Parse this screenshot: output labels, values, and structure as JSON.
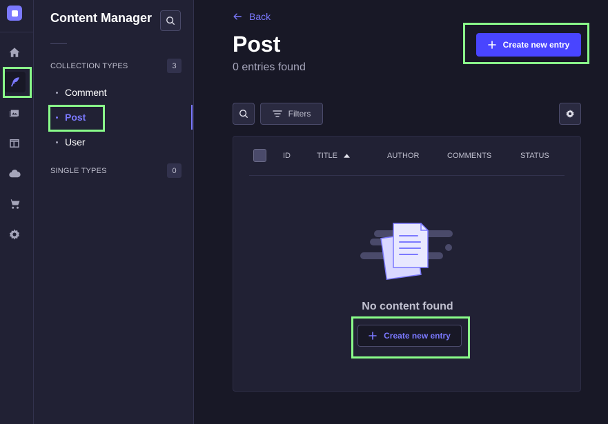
{
  "colors": {
    "background": "#181826",
    "panel": "#212134",
    "accent": "#7b79ff",
    "primary_button": "#4945ff",
    "highlight": "#8aff8a"
  },
  "rail": {
    "logo": "strapi-logo",
    "items": [
      {
        "icon": "home-icon"
      },
      {
        "icon": "feather-icon"
      },
      {
        "icon": "media-library-icon"
      },
      {
        "icon": "layout-icon"
      },
      {
        "icon": "cloud-icon"
      },
      {
        "icon": "cart-icon"
      },
      {
        "icon": "gear-icon"
      }
    ]
  },
  "subnav": {
    "title": "Content Manager",
    "search_icon": "search-icon",
    "collection_types": {
      "label": "COLLECTION TYPES",
      "count": "3",
      "items": [
        {
          "label": "Comment"
        },
        {
          "label": "Post"
        },
        {
          "label": "User"
        }
      ]
    },
    "single_types": {
      "label": "SINGLE TYPES",
      "count": "0"
    }
  },
  "header": {
    "back_label": "Back",
    "title": "Post",
    "subtitle": "0 entries found",
    "create_button_label": "Create new entry"
  },
  "toolbar": {
    "filters_label": "Filters"
  },
  "table": {
    "columns": [
      "ID",
      "TITLE",
      "AUTHOR",
      "COMMENTS",
      "STATUS"
    ],
    "empty_message": "No content found",
    "empty_create_label": "Create new entry"
  }
}
